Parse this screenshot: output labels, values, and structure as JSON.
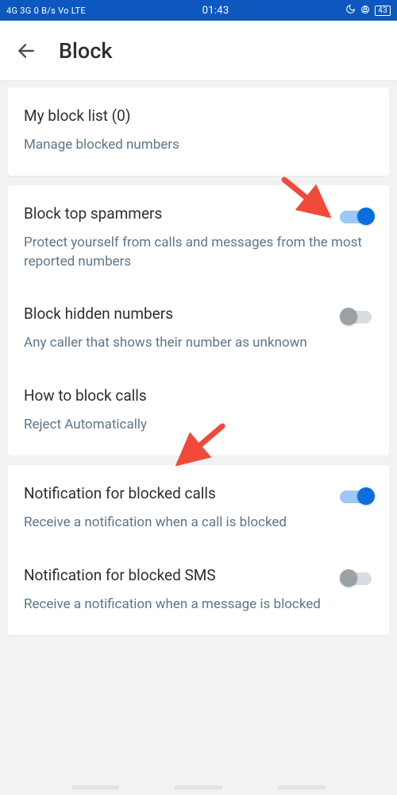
{
  "status": {
    "left": "4G 3G 0 B/s Vo LTE",
    "time": "01:43",
    "battery": "43"
  },
  "header": {
    "title": "Block"
  },
  "card1": {
    "blocklist": {
      "title": "My block list (0)",
      "sub": "Manage blocked numbers"
    }
  },
  "card2": {
    "topspam": {
      "title": "Block top spammers",
      "sub": "Protect yourself from calls and messages from the most reported numbers",
      "on": true
    },
    "hidden": {
      "title": "Block hidden numbers",
      "sub": "Any caller that shows their number as unknown",
      "on": false
    },
    "howto": {
      "title": "How to block calls",
      "sub": "Reject Automatically"
    }
  },
  "card3": {
    "notifcalls": {
      "title": "Notification for blocked calls",
      "sub": "Receive a notification when a call is blocked",
      "on": true
    },
    "notifsms": {
      "title": "Notification for blocked SMS",
      "sub": "Receive a notification when a message is blocked",
      "on": false
    }
  }
}
